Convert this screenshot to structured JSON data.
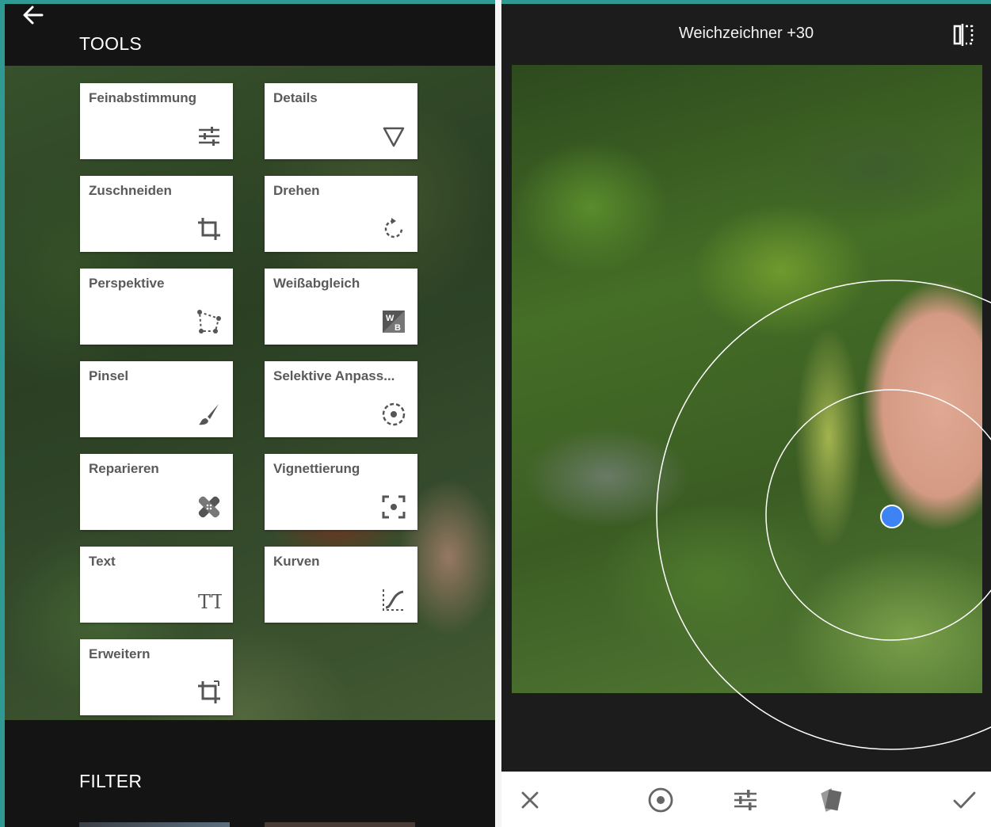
{
  "left_panel": {
    "tools_title": "TOOLS",
    "filter_title": "FILTER",
    "tools": [
      {
        "label": "Feinabstimmung",
        "icon": "sliders-icon"
      },
      {
        "label": "Details",
        "icon": "triangle-down-icon"
      },
      {
        "label": "Zuschneiden",
        "icon": "crop-icon"
      },
      {
        "label": "Drehen",
        "icon": "rotate-icon"
      },
      {
        "label": "Perspektive",
        "icon": "perspective-icon"
      },
      {
        "label": "Weißabgleich",
        "icon": "white-balance-icon"
      },
      {
        "label": "Pinsel",
        "icon": "brush-icon"
      },
      {
        "label": "Selektive Anpass...",
        "icon": "selective-target-icon"
      },
      {
        "label": "Reparieren",
        "icon": "healing-bandage-icon"
      },
      {
        "label": "Vignettierung",
        "icon": "vignette-icon"
      },
      {
        "label": "Text",
        "icon": "text-tt-icon"
      },
      {
        "label": "Kurven",
        "icon": "curves-icon"
      },
      {
        "label": "Erweitern",
        "icon": "expand-crop-icon"
      }
    ],
    "white_balance_glyph_w": "W",
    "white_balance_glyph_b": "B",
    "text_icon_glyph": "TT"
  },
  "right_panel": {
    "header_title": "Weichzeichner +30",
    "bottom_actions": [
      "close-icon",
      "target-icon",
      "sliders-icon",
      "styles-cards-icon",
      "checkmark-icon"
    ]
  },
  "colors": {
    "frame_teal": "#2f9a94",
    "handle_blue": "#3e83f4",
    "card_text": "#5a5a5a"
  }
}
